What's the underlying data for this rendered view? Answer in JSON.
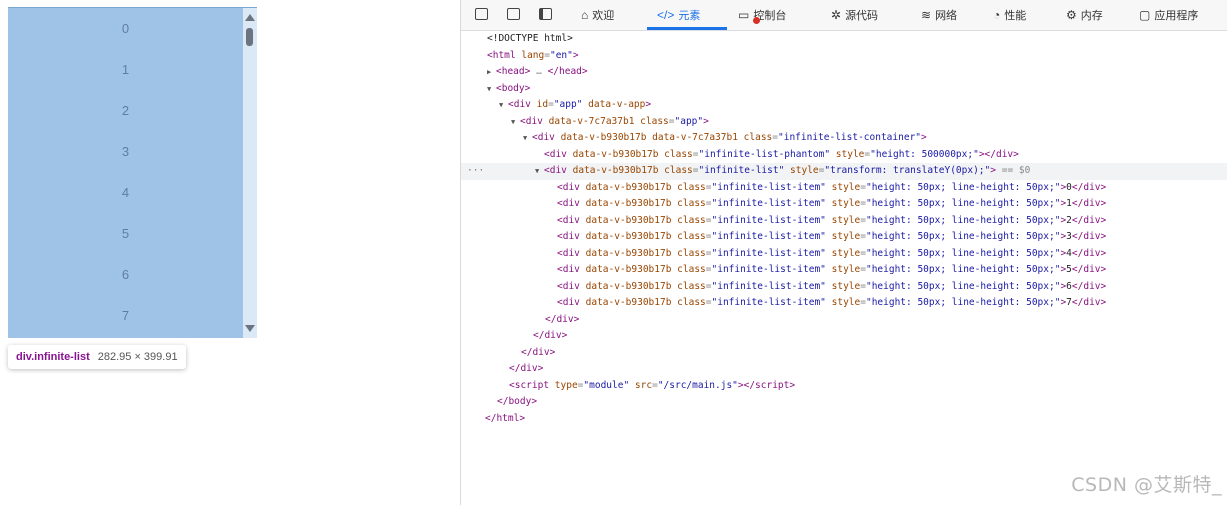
{
  "preview": {
    "list_items": [
      "0",
      "1",
      "2",
      "3",
      "4",
      "5",
      "6",
      "7"
    ],
    "tooltip": {
      "tag": "div.infinite-list",
      "size": "282.95 × 399.91"
    }
  },
  "devtools": {
    "tabs": [
      {
        "label": "欢迎",
        "glyph": "⌂"
      },
      {
        "label": "元素",
        "glyph": "</>",
        "active": true
      },
      {
        "label": "控制台",
        "glyph": "▭"
      },
      {
        "label": "源代码",
        "glyph": "✲"
      },
      {
        "label": "网络",
        "glyph": "≋"
      },
      {
        "label": "性能",
        "glyph": "◔"
      },
      {
        "label": "内存",
        "glyph": "⚙"
      },
      {
        "label": "应用程序",
        "glyph": "▢"
      }
    ],
    "dom": {
      "doctype": "<!DOCTYPE html>",
      "html_lang": "\"en\"",
      "head": "head",
      "head_ellipsis": "…",
      "app_id": "\"app\"",
      "data_v_app": "data-v-app",
      "app_dv": "data-v-7c7a37b1",
      "app_class": "\"app\"",
      "container_dv": "data-v-b930b17b data-v-7c7a37b1",
      "container_class": "\"infinite-list-container\"",
      "phantom_dv": "data-v-b930b17b",
      "phantom_class": "\"infinite-list-phantom\"",
      "phantom_style": "\"height: 500000px;\"",
      "list_dv": "data-v-b930b17b",
      "list_class": "\"infinite-list\"",
      "list_style": "\"transform: translateY(0px);\"",
      "selected_marker": "== $0",
      "item_dv": "data-v-b930b17b",
      "item_class": "\"infinite-list-item\"",
      "item_style": "\"height: 50px; line-height: 50px;\"",
      "items": [
        "0",
        "1",
        "2",
        "3",
        "4",
        "5",
        "6",
        "7"
      ],
      "script_type": "\"module\"",
      "script_src": "\"/src/main.js\""
    }
  },
  "watermark": "CSDN @艾斯特_"
}
